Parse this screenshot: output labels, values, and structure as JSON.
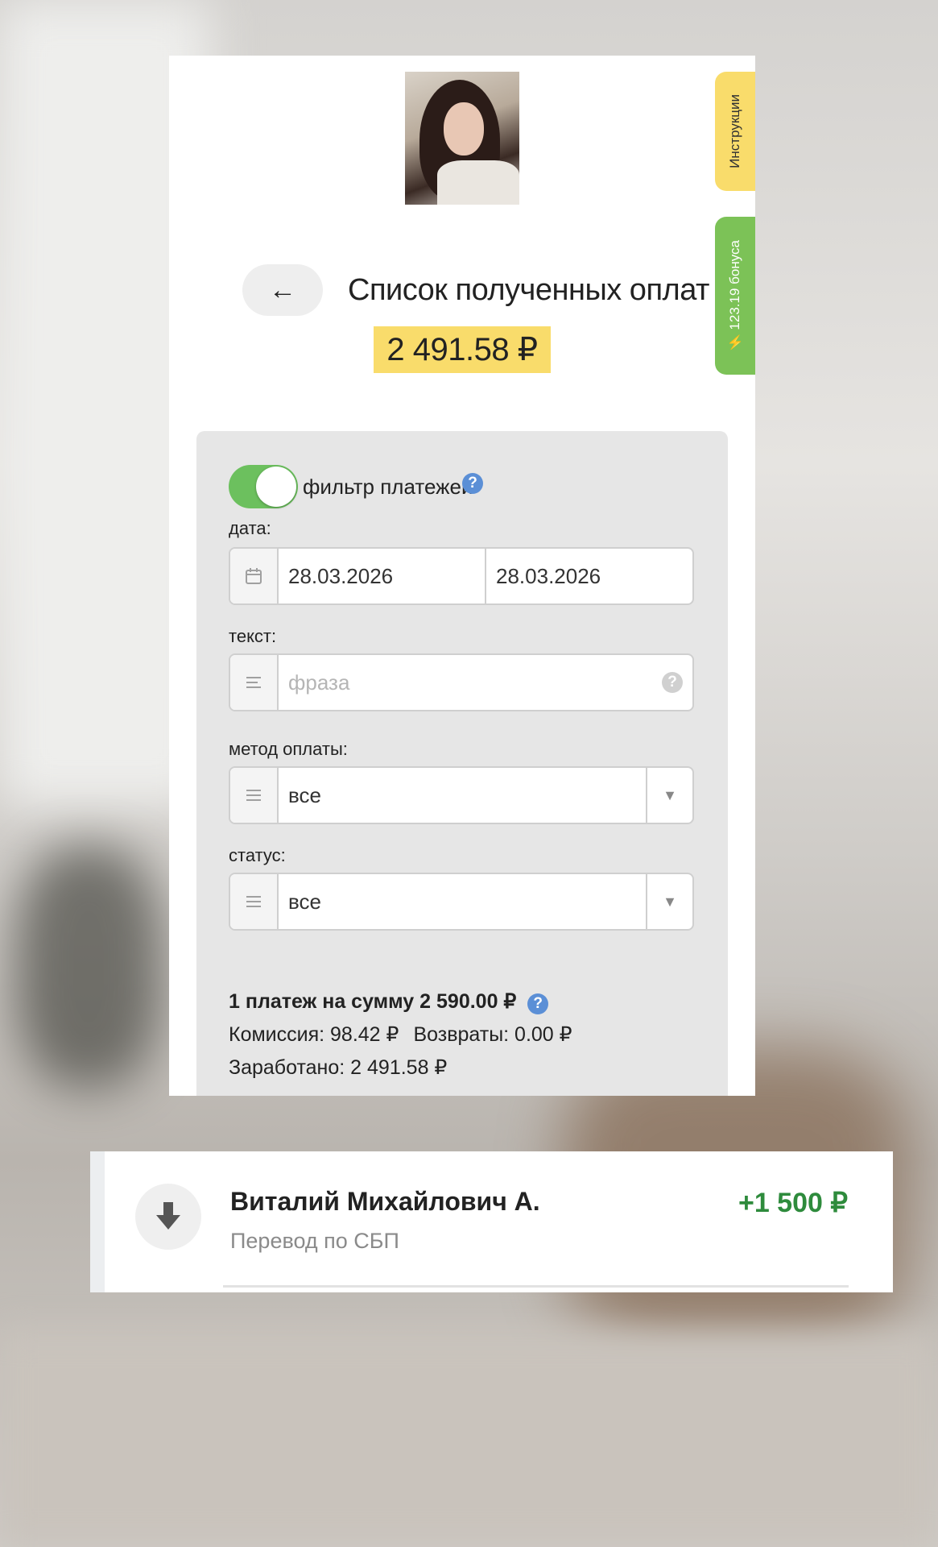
{
  "side_tabs": {
    "instructions": "Инструкции",
    "bonus": "123.19 бонуса"
  },
  "header": {
    "back_label": "←",
    "title": "Список полученных оплат",
    "balance": "2 491.58 ₽"
  },
  "filter": {
    "toggle_on": true,
    "toggle_label": "фильтр платежей",
    "date": {
      "label": "дата:",
      "from": "28.03.2026",
      "to": "28.03.2026"
    },
    "text": {
      "label": "текст:",
      "placeholder": "фраза"
    },
    "method": {
      "label": "метод оплаты:",
      "value": "все"
    },
    "status": {
      "label": "статус:",
      "value": "все"
    }
  },
  "summary": {
    "count_line": "1 платеж на сумму 2 590.00 ₽",
    "commission": "Комиссия: 98.42 ₽",
    "refunds": "Возвраты: 0.00 ₽",
    "earned": "Заработано: 2 491.58 ₽"
  },
  "payment": {
    "name": "Виталий Михайлович А.",
    "method": "Перевод по СБП",
    "amount": "+1 500 ₽",
    "amount_color": "#2e8b3c"
  },
  "colors": {
    "accent_yellow": "#f9dc6b",
    "accent_green": "#7cc257",
    "toggle_green": "#6cc05e",
    "help_blue": "#5b8fd6"
  }
}
